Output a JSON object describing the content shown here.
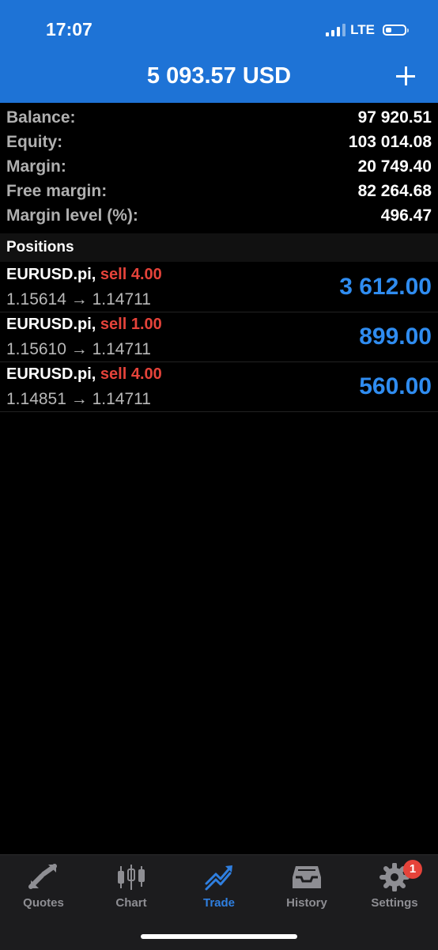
{
  "status": {
    "time": "17:07",
    "network": "LTE"
  },
  "header": {
    "title": "5 093.57 USD"
  },
  "summary": [
    {
      "label": "Balance:",
      "value": "97 920.51"
    },
    {
      "label": "Equity:",
      "value": "103 014.08"
    },
    {
      "label": "Margin:",
      "value": "20 749.40"
    },
    {
      "label": "Free margin:",
      "value": "82 264.68"
    },
    {
      "label": "Margin level (%):",
      "value": "496.47"
    }
  ],
  "positions": {
    "title": "Positions",
    "items": [
      {
        "symbol": "EURUSD.pi,",
        "direction": "sell 4.00",
        "prices": "1.15614 → 1.14711",
        "profit": "3 612.00"
      },
      {
        "symbol": "EURUSD.pi,",
        "direction": "sell 1.00",
        "prices": "1.15610 → 1.14711",
        "profit": "899.00"
      },
      {
        "symbol": "EURUSD.pi,",
        "direction": "sell 4.00",
        "prices": "1.14851 → 1.14711",
        "profit": "560.00"
      }
    ]
  },
  "tabs": [
    {
      "label": "Quotes",
      "icon": "quotes-icon"
    },
    {
      "label": "Chart",
      "icon": "chart-icon"
    },
    {
      "label": "Trade",
      "icon": "trade-icon",
      "active": true
    },
    {
      "label": "History",
      "icon": "history-icon"
    },
    {
      "label": "Settings",
      "icon": "settings-icon",
      "badge": "1"
    }
  ],
  "colors": {
    "header": "#1e73d6",
    "sell": "#e5433a",
    "profit": "#2f8cf0",
    "active_tab": "#2f7fe0"
  }
}
